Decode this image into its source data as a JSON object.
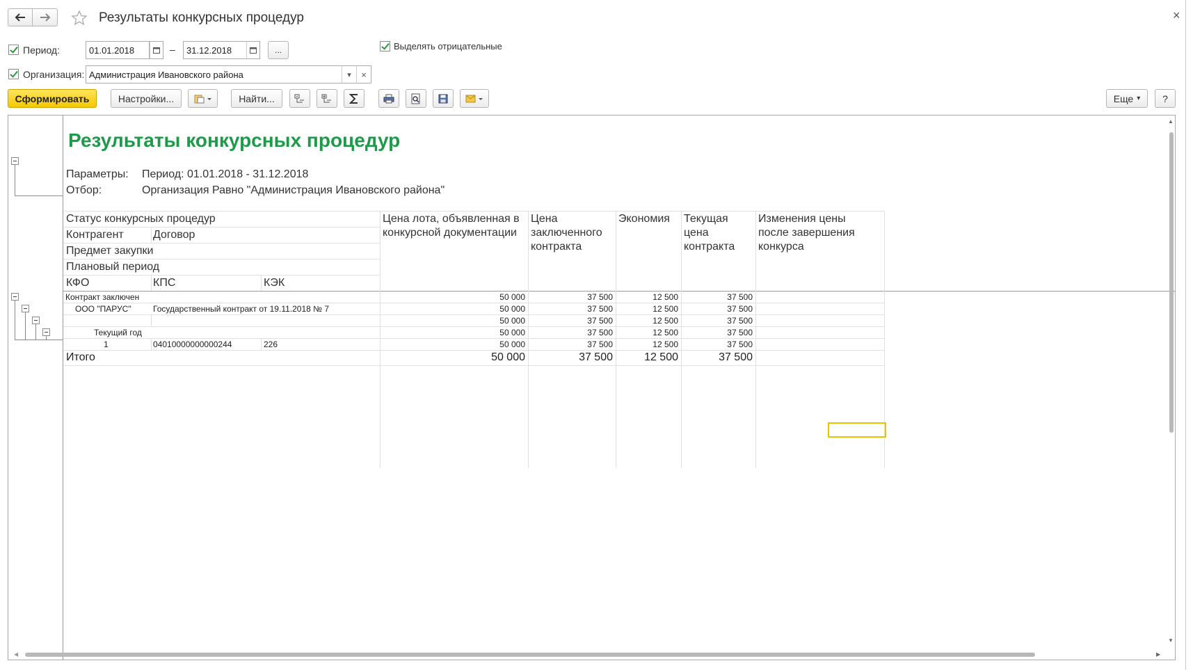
{
  "window": {
    "title": "Результаты конкурсных процедур",
    "close": "×"
  },
  "filters": {
    "period_label": "Период:",
    "period_from": "01.01.2018",
    "period_dash": "–",
    "period_to": "31.12.2018",
    "period_more": "...",
    "highlight_negative_label": "Выделять отрицательные",
    "org_label": "Организация:",
    "org_value": "Администрация Ивановского района",
    "org_clear": "×"
  },
  "toolbar": {
    "generate": "Сформировать",
    "settings": "Настройки...",
    "find": "Найти...",
    "more": "Еще",
    "help": "?"
  },
  "report": {
    "title": "Результаты конкурсных процедур",
    "params_label": "Параметры:",
    "params_value": "Период: 01.01.2018 - 31.12.2018",
    "filter_label": "Отбор:",
    "filter_value": "Организация Равно \"Администрация Ивановского района\"",
    "headers": {
      "status": "Статус конкурсных процедур",
      "counterparty": "Контрагент",
      "contract": "Договор",
      "subject": "Предмет закупки",
      "plan_period": "Плановый период",
      "kfo": "КФО",
      "kps": "КПС",
      "kek": "КЭК",
      "lot_price": "Цена лота, объявленная в конкурсной документации",
      "contract_price": "Цена заключенного контракта",
      "savings": "Экономия",
      "current_price": "Текущая цена контракта",
      "price_changes": "Изменения цены после завершения конкурса"
    },
    "rows": [
      {
        "c1": "Контракт заключен",
        "c2": "",
        "c3": "",
        "lot": "50 000",
        "contract": "37 500",
        "savings": "12 500",
        "current": "37 500"
      },
      {
        "c1": "ООО \"ПАРУС\"",
        "c2": "Государственный контракт от 19.11.2018 № 7",
        "c3": "",
        "lot": "50 000",
        "contract": "37 500",
        "savings": "12 500",
        "current": "37 500"
      },
      {
        "c1": "",
        "c2": "",
        "c3": "",
        "lot": "50 000",
        "contract": "37 500",
        "savings": "12 500",
        "current": "37 500"
      },
      {
        "c1": "Текущий год",
        "c2": "",
        "c3": "",
        "lot": "50 000",
        "contract": "37 500",
        "savings": "12 500",
        "current": "37 500"
      },
      {
        "c1": "1",
        "c2": "04010000000000244",
        "c3": "226",
        "lot": "50 000",
        "contract": "37 500",
        "savings": "12 500",
        "current": "37 500"
      }
    ],
    "total": {
      "label": "Итого",
      "lot": "50 000",
      "contract": "37 500",
      "savings": "12 500",
      "current": "37 500"
    }
  }
}
